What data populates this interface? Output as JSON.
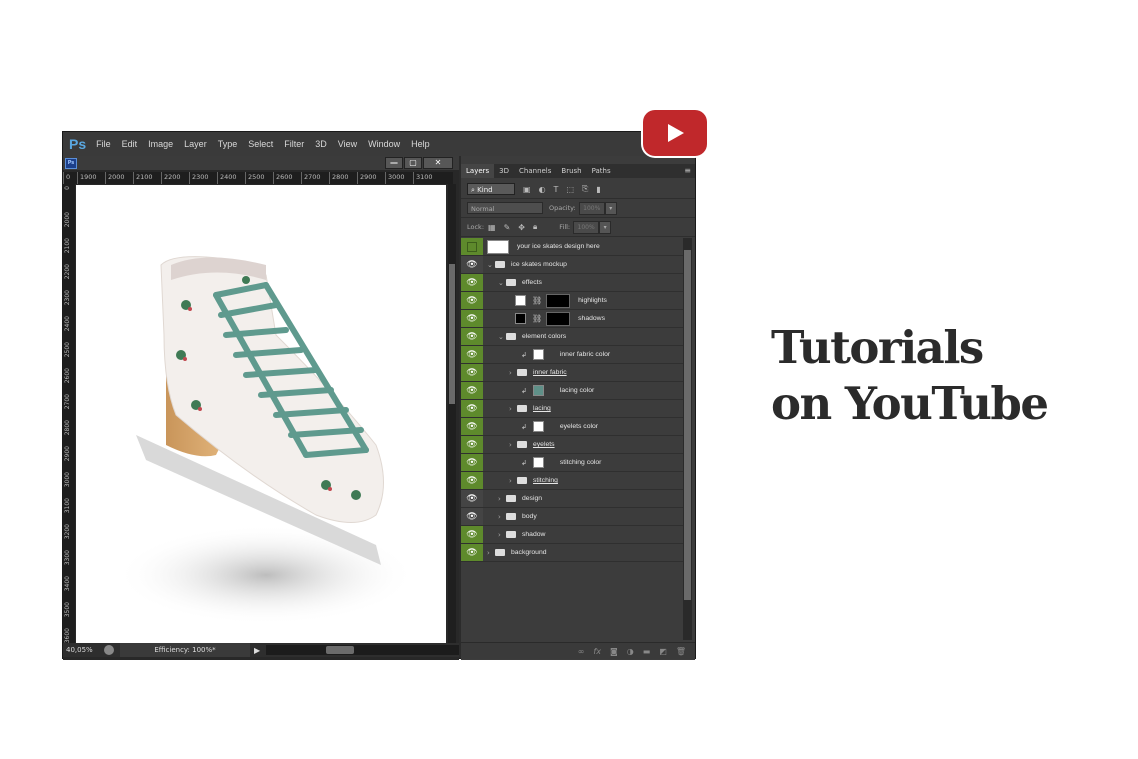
{
  "app": {
    "logo": "Ps",
    "menu": [
      "File",
      "Edit",
      "Image",
      "Layer",
      "Type",
      "Select",
      "Filter",
      "3D",
      "View",
      "Window",
      "Help"
    ]
  },
  "document": {
    "icon": "Ps",
    "window_buttons": {
      "minimize": "—",
      "maximize": "▢",
      "close": "✕"
    },
    "ruler_h": [
      "0",
      "1900",
      "2000",
      "2100",
      "2200",
      "2300",
      "2400",
      "2500",
      "2600",
      "2700",
      "2800",
      "2900",
      "3000",
      "3100"
    ],
    "ruler_v": [
      "0",
      "2000",
      "2100",
      "2200",
      "2300",
      "2400",
      "2500",
      "2600",
      "2700",
      "2800",
      "2900",
      "3000",
      "3100",
      "3200",
      "3300",
      "3400",
      "3500",
      "3600"
    ],
    "zoom": "40,05%",
    "efficiency": "Efficiency: 100%*"
  },
  "panel": {
    "tabs": [
      "Layers",
      "3D",
      "Channels",
      "Brush",
      "Paths"
    ],
    "kind_label": "Kind",
    "blend_mode": "Normal",
    "opacity_label": "Opacity:",
    "opacity_value": "100%",
    "lock_label": "Lock:",
    "fill_label": "Fill:",
    "fill_value": "100%",
    "layers": [
      {
        "name": "your ice skates design here",
        "type": "smart",
        "visible": false,
        "indent": 0
      },
      {
        "name": "ice skates mockup",
        "type": "group-open",
        "visible": true,
        "indent": 0
      },
      {
        "name": "effects",
        "type": "group-open",
        "visible": true,
        "indent": 1
      },
      {
        "name": "highlights",
        "type": "fill-mask",
        "visible": true,
        "indent": 2,
        "color": "#ffffff"
      },
      {
        "name": "shadows",
        "type": "fill-mask",
        "visible": true,
        "indent": 2,
        "color": "#000000"
      },
      {
        "name": "element colors",
        "type": "group-open",
        "visible": true,
        "indent": 1
      },
      {
        "name": "inner fabric color",
        "type": "fill-clip",
        "visible": true,
        "indent": 2,
        "color": "#ffffff"
      },
      {
        "name": "inner fabric",
        "type": "group-closed",
        "visible": true,
        "indent": 2,
        "underline": true
      },
      {
        "name": "lacing color",
        "type": "fill-clip",
        "visible": true,
        "indent": 2,
        "color": "#5f9088"
      },
      {
        "name": "lacing",
        "type": "group-closed",
        "visible": true,
        "indent": 2,
        "underline": true
      },
      {
        "name": "eyelets color",
        "type": "fill-clip",
        "visible": true,
        "indent": 2,
        "color": "#ffffff"
      },
      {
        "name": "eyelets",
        "type": "group-closed",
        "visible": true,
        "indent": 2,
        "underline": true
      },
      {
        "name": "stitching color",
        "type": "fill-clip",
        "visible": true,
        "indent": 2,
        "color": "#ffffff"
      },
      {
        "name": "stitching",
        "type": "group-closed",
        "visible": true,
        "indent": 2,
        "underline": true
      },
      {
        "name": "design",
        "type": "group-closed",
        "visible": true,
        "indent": 1
      },
      {
        "name": "body",
        "type": "group-closed",
        "visible": true,
        "indent": 1
      },
      {
        "name": "shadow",
        "type": "group-closed",
        "visible": true,
        "indent": 1
      },
      {
        "name": "background",
        "type": "group-closed",
        "visible": true,
        "indent": 0
      }
    ],
    "footer_icons": [
      "link-icon",
      "fx-icon",
      "mask-icon",
      "adjustment-icon",
      "folder-icon",
      "new-layer-icon",
      "trash-icon"
    ]
  },
  "headline": {
    "line1": "Tutorials",
    "line2": "on YouTube"
  },
  "colors": {
    "youtube_red": "#c0282b",
    "layer_green": "#5e8a2c",
    "lace_teal": "#5f9a8e"
  }
}
